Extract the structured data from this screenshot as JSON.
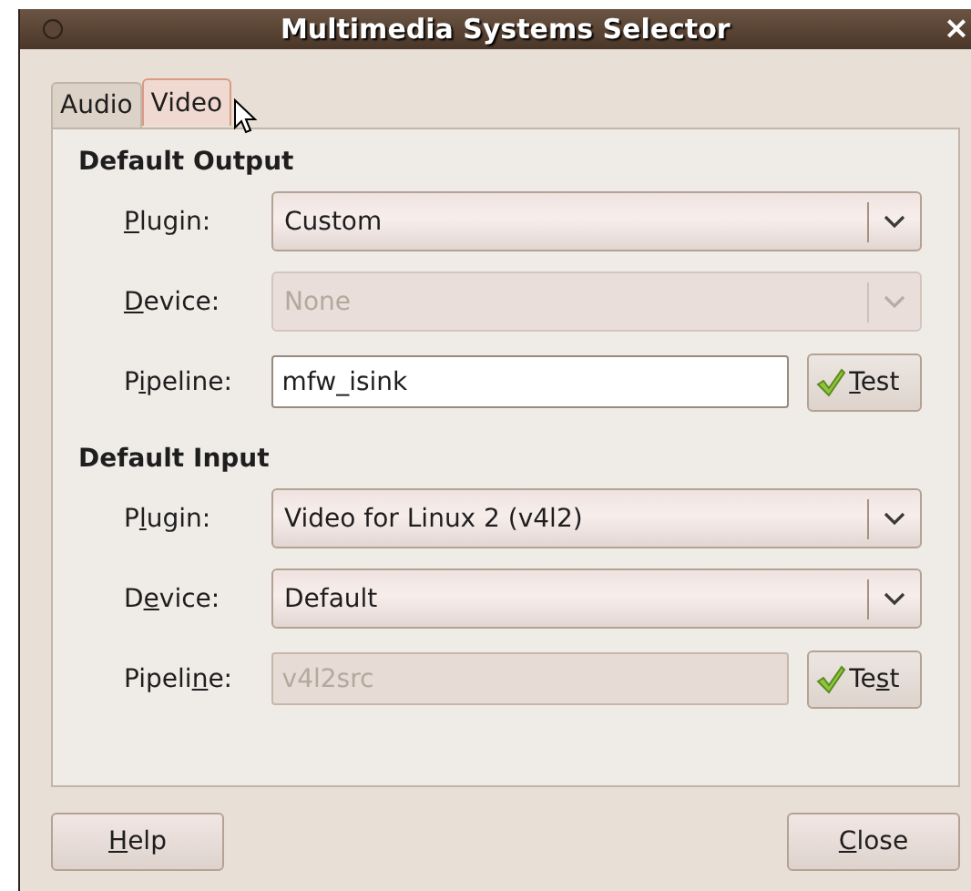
{
  "window": {
    "title": "Multimedia Systems Selector",
    "close_glyph": "×"
  },
  "tabs": [
    {
      "label": "Audio",
      "selected": false
    },
    {
      "label": "Video",
      "selected": true
    }
  ],
  "sections": [
    {
      "heading": "Default Output",
      "rows": [
        {
          "kind": "combo",
          "label_key": "P",
          "label_post": "lugin:",
          "value": "Custom",
          "disabled": false
        },
        {
          "kind": "combo",
          "label_key": "D",
          "label_post": "evice:",
          "value": "None",
          "disabled": true
        },
        {
          "kind": "entry",
          "label_pre": "P",
          "label_key": "i",
          "label_post": "peline:",
          "value": "mfw_isink",
          "disabled": false,
          "button": {
            "key": "T",
            "post": "est"
          }
        }
      ]
    },
    {
      "heading": "Default Input",
      "rows": [
        {
          "kind": "combo",
          "label_pre": "P",
          "label_key": "l",
          "label_post": "ugin:",
          "value": "Video for Linux 2 (v4l2)",
          "disabled": false
        },
        {
          "kind": "combo",
          "label_pre": "D",
          "label_key": "e",
          "label_post": "vice:",
          "value": "Default",
          "disabled": false
        },
        {
          "kind": "entry",
          "label_pre": "Pipeli",
          "label_key": "n",
          "label_post": "e:",
          "value": "v4l2src",
          "disabled": true,
          "button": {
            "pre": "Te",
            "key": "s",
            "post": "t"
          }
        }
      ]
    }
  ],
  "buttons": [
    {
      "key": "H",
      "post": "elp"
    },
    {
      "key": "C",
      "post": "lose"
    }
  ]
}
